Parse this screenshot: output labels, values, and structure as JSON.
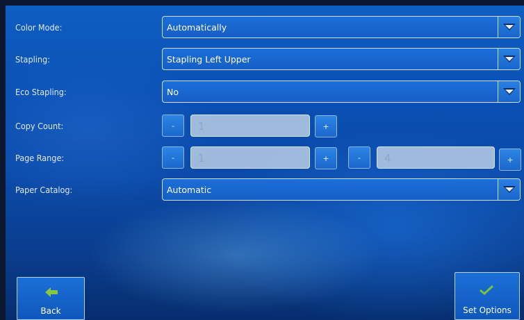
{
  "colors": {
    "accent": "#155fc6",
    "border": "#cfe0f6",
    "back_arrow": "#86c843",
    "check": "#7cc23b"
  },
  "fields": {
    "color_mode": {
      "label": "Color Mode:",
      "value": "Automatically"
    },
    "stapling": {
      "label": "Stapling:",
      "value": "Stapling Left Upper"
    },
    "eco_stapling": {
      "label": "Eco Stapling:",
      "value": "No"
    },
    "copy_count": {
      "label": "Copy Count:",
      "value": "1",
      "minus": "-",
      "plus": "+"
    },
    "page_range": {
      "label": "Page Range:",
      "from": "1",
      "to": "4",
      "minus": "-",
      "plus": "+"
    },
    "paper_catalog": {
      "label": "Paper Catalog:",
      "value": "Automatic"
    }
  },
  "footer": {
    "back_label": "Back",
    "set_options_label": "Set Options"
  },
  "icons": {
    "dropdown": "triangle-down-icon",
    "back": "arrow-left-icon",
    "confirm": "checkmark-icon"
  }
}
